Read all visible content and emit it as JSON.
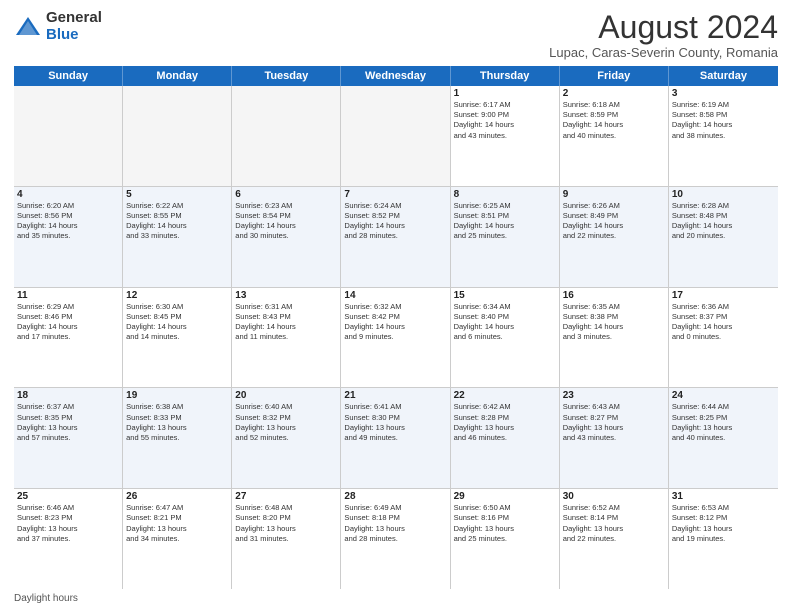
{
  "header": {
    "logo_general": "General",
    "logo_blue": "Blue",
    "main_title": "August 2024",
    "subtitle": "Lupac, Caras-Severin County, Romania"
  },
  "days_of_week": [
    "Sunday",
    "Monday",
    "Tuesday",
    "Wednesday",
    "Thursday",
    "Friday",
    "Saturday"
  ],
  "footer": {
    "label": "Daylight hours"
  },
  "weeks": [
    {
      "alt": false,
      "cells": [
        {
          "day": "",
          "text": ""
        },
        {
          "day": "",
          "text": ""
        },
        {
          "day": "",
          "text": ""
        },
        {
          "day": "",
          "text": ""
        },
        {
          "day": "1",
          "text": "Sunrise: 6:17 AM\nSunset: 9:00 PM\nDaylight: 14 hours\nand 43 minutes."
        },
        {
          "day": "2",
          "text": "Sunrise: 6:18 AM\nSunset: 8:59 PM\nDaylight: 14 hours\nand 40 minutes."
        },
        {
          "day": "3",
          "text": "Sunrise: 6:19 AM\nSunset: 8:58 PM\nDaylight: 14 hours\nand 38 minutes."
        }
      ]
    },
    {
      "alt": true,
      "cells": [
        {
          "day": "4",
          "text": "Sunrise: 6:20 AM\nSunset: 8:56 PM\nDaylight: 14 hours\nand 35 minutes."
        },
        {
          "day": "5",
          "text": "Sunrise: 6:22 AM\nSunset: 8:55 PM\nDaylight: 14 hours\nand 33 minutes."
        },
        {
          "day": "6",
          "text": "Sunrise: 6:23 AM\nSunset: 8:54 PM\nDaylight: 14 hours\nand 30 minutes."
        },
        {
          "day": "7",
          "text": "Sunrise: 6:24 AM\nSunset: 8:52 PM\nDaylight: 14 hours\nand 28 minutes."
        },
        {
          "day": "8",
          "text": "Sunrise: 6:25 AM\nSunset: 8:51 PM\nDaylight: 14 hours\nand 25 minutes."
        },
        {
          "day": "9",
          "text": "Sunrise: 6:26 AM\nSunset: 8:49 PM\nDaylight: 14 hours\nand 22 minutes."
        },
        {
          "day": "10",
          "text": "Sunrise: 6:28 AM\nSunset: 8:48 PM\nDaylight: 14 hours\nand 20 minutes."
        }
      ]
    },
    {
      "alt": false,
      "cells": [
        {
          "day": "11",
          "text": "Sunrise: 6:29 AM\nSunset: 8:46 PM\nDaylight: 14 hours\nand 17 minutes."
        },
        {
          "day": "12",
          "text": "Sunrise: 6:30 AM\nSunset: 8:45 PM\nDaylight: 14 hours\nand 14 minutes."
        },
        {
          "day": "13",
          "text": "Sunrise: 6:31 AM\nSunset: 8:43 PM\nDaylight: 14 hours\nand 11 minutes."
        },
        {
          "day": "14",
          "text": "Sunrise: 6:32 AM\nSunset: 8:42 PM\nDaylight: 14 hours\nand 9 minutes."
        },
        {
          "day": "15",
          "text": "Sunrise: 6:34 AM\nSunset: 8:40 PM\nDaylight: 14 hours\nand 6 minutes."
        },
        {
          "day": "16",
          "text": "Sunrise: 6:35 AM\nSunset: 8:38 PM\nDaylight: 14 hours\nand 3 minutes."
        },
        {
          "day": "17",
          "text": "Sunrise: 6:36 AM\nSunset: 8:37 PM\nDaylight: 14 hours\nand 0 minutes."
        }
      ]
    },
    {
      "alt": true,
      "cells": [
        {
          "day": "18",
          "text": "Sunrise: 6:37 AM\nSunset: 8:35 PM\nDaylight: 13 hours\nand 57 minutes."
        },
        {
          "day": "19",
          "text": "Sunrise: 6:38 AM\nSunset: 8:33 PM\nDaylight: 13 hours\nand 55 minutes."
        },
        {
          "day": "20",
          "text": "Sunrise: 6:40 AM\nSunset: 8:32 PM\nDaylight: 13 hours\nand 52 minutes."
        },
        {
          "day": "21",
          "text": "Sunrise: 6:41 AM\nSunset: 8:30 PM\nDaylight: 13 hours\nand 49 minutes."
        },
        {
          "day": "22",
          "text": "Sunrise: 6:42 AM\nSunset: 8:28 PM\nDaylight: 13 hours\nand 46 minutes."
        },
        {
          "day": "23",
          "text": "Sunrise: 6:43 AM\nSunset: 8:27 PM\nDaylight: 13 hours\nand 43 minutes."
        },
        {
          "day": "24",
          "text": "Sunrise: 6:44 AM\nSunset: 8:25 PM\nDaylight: 13 hours\nand 40 minutes."
        }
      ]
    },
    {
      "alt": false,
      "cells": [
        {
          "day": "25",
          "text": "Sunrise: 6:46 AM\nSunset: 8:23 PM\nDaylight: 13 hours\nand 37 minutes."
        },
        {
          "day": "26",
          "text": "Sunrise: 6:47 AM\nSunset: 8:21 PM\nDaylight: 13 hours\nand 34 minutes."
        },
        {
          "day": "27",
          "text": "Sunrise: 6:48 AM\nSunset: 8:20 PM\nDaylight: 13 hours\nand 31 minutes."
        },
        {
          "day": "28",
          "text": "Sunrise: 6:49 AM\nSunset: 8:18 PM\nDaylight: 13 hours\nand 28 minutes."
        },
        {
          "day": "29",
          "text": "Sunrise: 6:50 AM\nSunset: 8:16 PM\nDaylight: 13 hours\nand 25 minutes."
        },
        {
          "day": "30",
          "text": "Sunrise: 6:52 AM\nSunset: 8:14 PM\nDaylight: 13 hours\nand 22 minutes."
        },
        {
          "day": "31",
          "text": "Sunrise: 6:53 AM\nSunset: 8:12 PM\nDaylight: 13 hours\nand 19 minutes."
        }
      ]
    }
  ]
}
